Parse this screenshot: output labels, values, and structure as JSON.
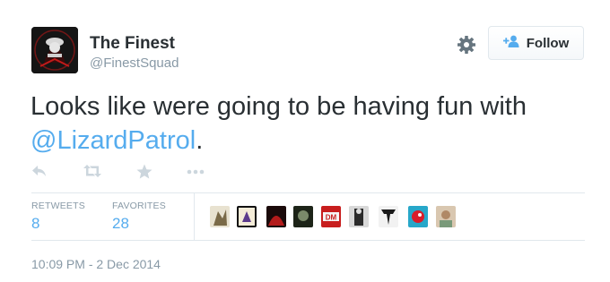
{
  "tweet": {
    "author_name": "The Finest",
    "author_handle": "@FinestSquad",
    "follow_label": "Follow",
    "text_before": "Looks like were going to be having fun with ",
    "mention": "@LizardPatrol",
    "text_after": ".",
    "stats": {
      "retweets_label": "RETWEETS",
      "retweets": "8",
      "favorites_label": "FAVORITES",
      "favorites": "28"
    },
    "favoriter_avatars": [
      "avatar-1",
      "avatar-2",
      "avatar-3",
      "avatar-4",
      "avatar-5",
      "avatar-6",
      "avatar-7",
      "avatar-8",
      "avatar-9"
    ],
    "timestamp": "10:09 PM - 2 Dec 2014"
  },
  "icons": {
    "actions": [
      "reply-icon",
      "retweet-icon",
      "favorite-icon",
      "more-icon"
    ],
    "settings": "gear-icon",
    "follow": "add-user-icon"
  },
  "colors": {
    "link": "#55acee",
    "muted": "#8899a6",
    "text": "#292f33",
    "icon": "#ccd6dd"
  }
}
